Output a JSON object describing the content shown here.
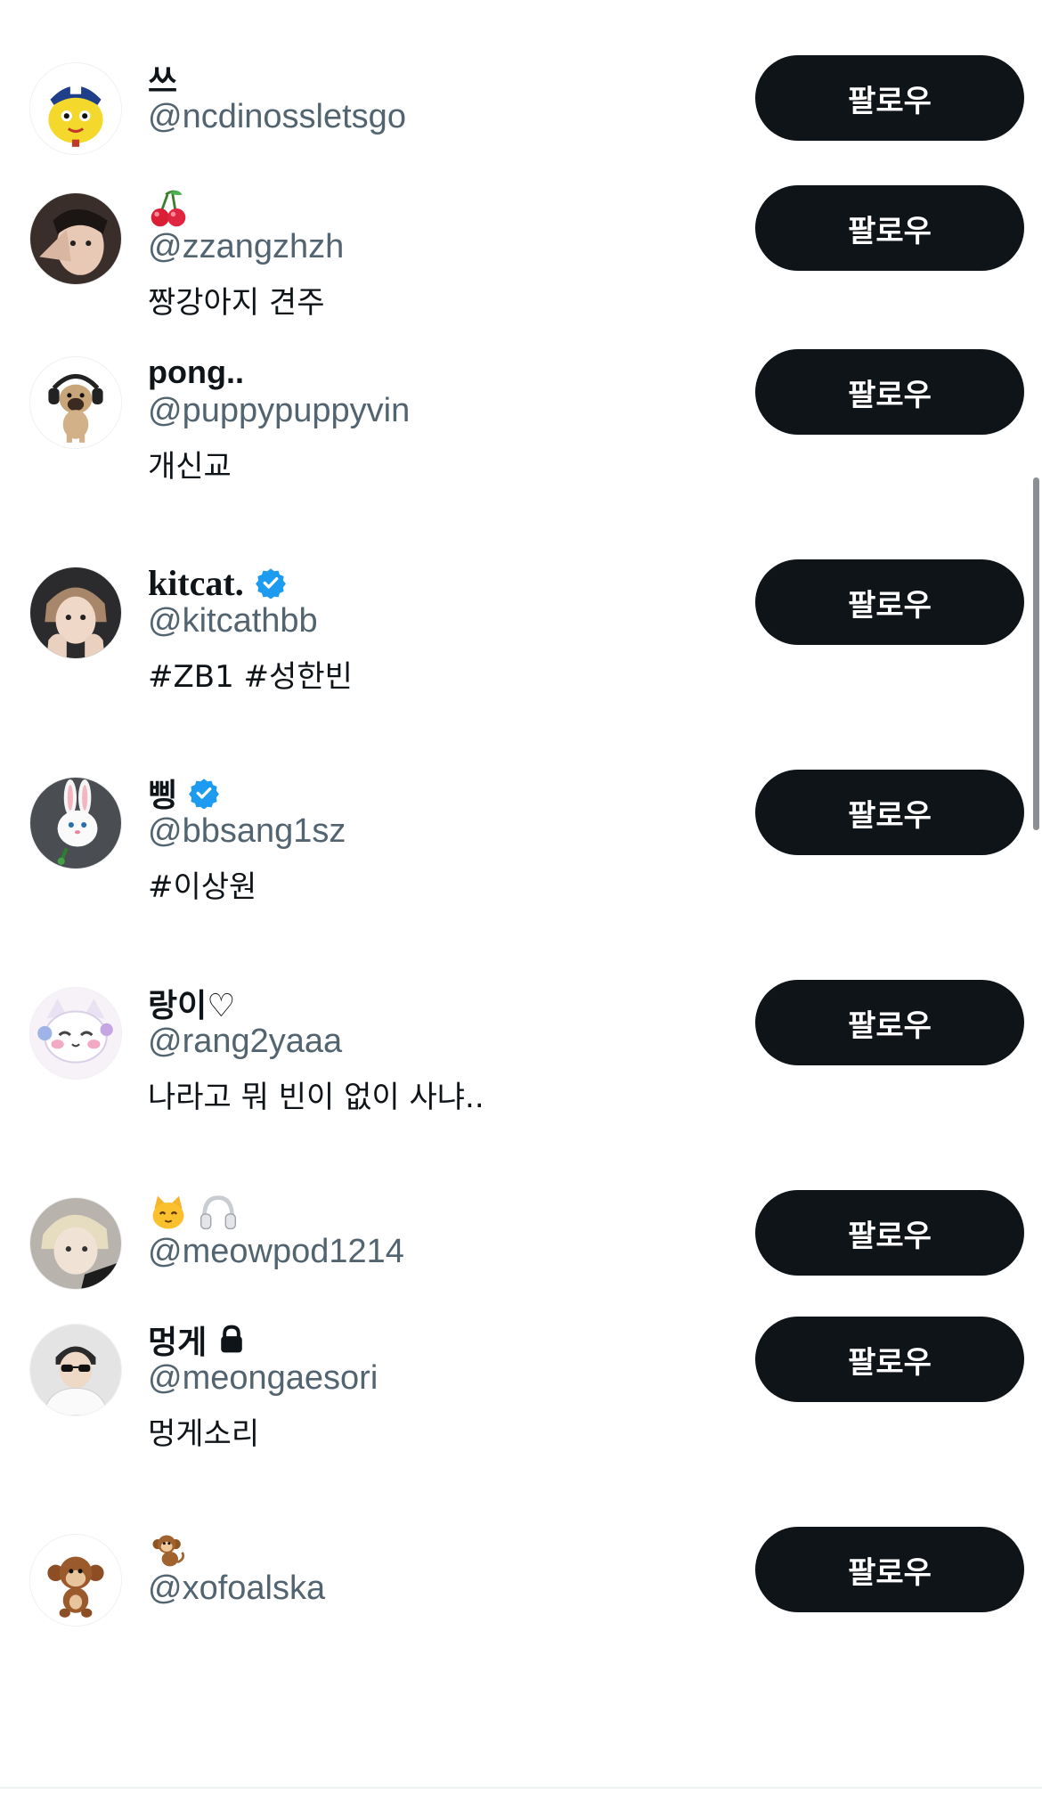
{
  "follow_label": "팔로우",
  "accounts": [
    {
      "name": "쓰",
      "name_emoji": "",
      "handle": "@ncdinossletsgo",
      "bio": "",
      "verified": false,
      "protected": false,
      "avatar_icon": "dino-mascot-icon"
    },
    {
      "name": "",
      "name_emoji": "cherry-emoji",
      "handle": "@zzangzhzh",
      "bio": "짱강아지 견주",
      "verified": false,
      "protected": false,
      "avatar_icon": "person-heart-pose-photo"
    },
    {
      "name": "pong..",
      "name_emoji": "",
      "handle": "@puppypuppyvin",
      "bio": "개신교",
      "verified": false,
      "protected": false,
      "avatar_icon": "pug-headphones-photo"
    },
    {
      "name": "kitcat.",
      "name_emoji": "",
      "handle": "@kitcathbb",
      "bio": "#ZB1 #성한빈",
      "verified": true,
      "protected": false,
      "avatar_icon": "person-hands-face-photo"
    },
    {
      "name": "삥",
      "name_emoji": "",
      "handle": "@bbsang1sz",
      "bio": "#이상원",
      "verified": true,
      "protected": false,
      "avatar_icon": "white-bunny-photo"
    },
    {
      "name": "랑이♡",
      "name_emoji": "",
      "handle": "@rang2yaaa",
      "bio": "나라고 뭐 빈이 없이 사냐..",
      "verified": false,
      "protected": false,
      "avatar_icon": "cartoon-cat-icon"
    },
    {
      "name": "",
      "name_emoji": "cat-headphones-emoji",
      "handle": "@meowpod1214",
      "bio": "",
      "verified": false,
      "protected": false,
      "avatar_icon": "blonde-person-photo"
    },
    {
      "name": "멍게",
      "name_emoji": "",
      "handle": "@meongaesori",
      "bio": "멍게소리",
      "verified": false,
      "protected": true,
      "avatar_icon": "person-sunglasses-photo"
    },
    {
      "name": "",
      "name_emoji": "monkey-emoji",
      "handle": "@xofoalska",
      "bio": "",
      "verified": false,
      "protected": false,
      "avatar_icon": "toy-monkey-photo"
    }
  ],
  "colors": {
    "text_primary": "#0f1419",
    "text_secondary": "#536471",
    "button_bg": "#0f1419",
    "button_text": "#ffffff",
    "verified_blue": "#1d9bf0"
  }
}
